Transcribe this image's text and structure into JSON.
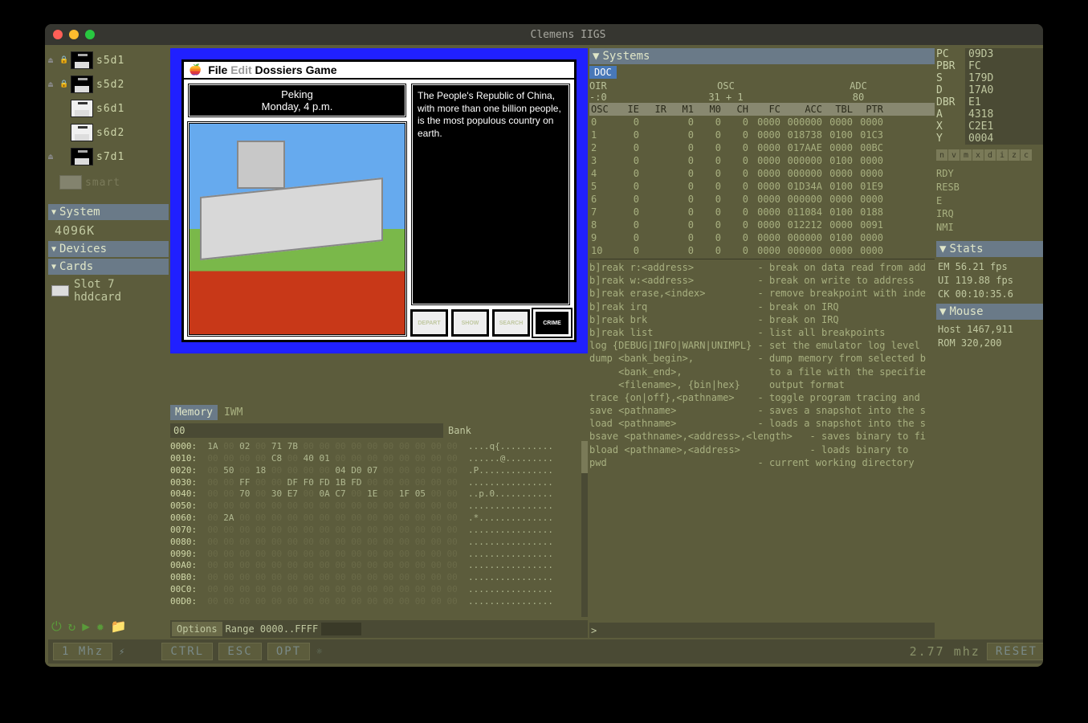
{
  "window_title": "Clemens IIGS",
  "drives": [
    {
      "label": "s5d1",
      "icon": "floppy-dark",
      "eject": true,
      "locked": true
    },
    {
      "label": "s5d2",
      "icon": "floppy-dark",
      "eject": true,
      "locked": true
    },
    {
      "label": "s6d1",
      "icon": "floppy-white",
      "eject": false,
      "locked": false
    },
    {
      "label": "s6d2",
      "icon": "floppy-white",
      "eject": false,
      "locked": false
    },
    {
      "label": "s7d1",
      "icon": "hdd",
      "eject": true,
      "locked": false
    }
  ],
  "smart_label": "smart",
  "sections": {
    "system": "System",
    "devices": "Devices",
    "cards": "Cards"
  },
  "system_memory": "4096K",
  "card_slot": {
    "label": "Slot 7",
    "sublabel": "hddcard"
  },
  "game": {
    "menus": [
      "File",
      "Edit",
      "Dossiers",
      "Game"
    ],
    "menu_disabled_index": 1,
    "location": "Peking",
    "when": "Monday, 4 p.m.",
    "text": "The People's Republic of China, with more than one billion people, is the most populous country on earth.",
    "buttons": [
      "DEPART",
      "SHOW",
      "SEARCH",
      "CRIME"
    ]
  },
  "memory": {
    "tabs": [
      "Memory",
      "IWM"
    ],
    "active_tab": 0,
    "bank_value": "00",
    "bank_label": "Bank",
    "rows": [
      {
        "addr": "0000:",
        "bytes": "1A 00 02 00 71 7B 00 00 00 00 00 00 00 00 00 00",
        "ascii": "....q{.........."
      },
      {
        "addr": "0010:",
        "bytes": "00 00 00 00 C8 00 40 01 00 00 00 00 00 00 00 00",
        "ascii": "......@........."
      },
      {
        "addr": "0020:",
        "bytes": "00 50 00 18 00 00 00 00 04 D0 07 00 00 00 00 00",
        "ascii": ".P.............."
      },
      {
        "addr": "0030:",
        "bytes": "00 00 FF 00 00 DF F0 FD 1B FD 00 00 00 00 00 00",
        "ascii": "................"
      },
      {
        "addr": "0040:",
        "bytes": "00 00 70 00 30 E7 00 0A C7 00 1E 00 1F 05 00 00",
        "ascii": "..p.0..........."
      },
      {
        "addr": "0050:",
        "bytes": "00 00 00 00 00 00 00 00 00 00 00 00 00 00 00 00",
        "ascii": "................"
      },
      {
        "addr": "0060:",
        "bytes": "00 2A 00 00 00 00 00 00 00 00 00 00 00 00 00 00",
        "ascii": ".*.............."
      },
      {
        "addr": "0070:",
        "bytes": "00 00 00 00 00 00 00 00 00 00 00 00 00 00 00 00",
        "ascii": "................"
      },
      {
        "addr": "0080:",
        "bytes": "00 00 00 00 00 00 00 00 00 00 00 00 00 00 00 00",
        "ascii": "................"
      },
      {
        "addr": "0090:",
        "bytes": "00 00 00 00 00 00 00 00 00 00 00 00 00 00 00 00",
        "ascii": "................"
      },
      {
        "addr": "00A0:",
        "bytes": "00 00 00 00 00 00 00 00 00 00 00 00 00 00 00 00",
        "ascii": "................"
      },
      {
        "addr": "00B0:",
        "bytes": "00 00 00 00 00 00 00 00 00 00 00 00 00 00 00 00",
        "ascii": "................"
      },
      {
        "addr": "00C0:",
        "bytes": "00 00 00 00 00 00 00 00 00 00 00 00 00 00 00 00",
        "ascii": "................"
      },
      {
        "addr": "00D0:",
        "bytes": "00 00 00 00 00 00 00 00 00 00 00 00 00 00 00 00",
        "ascii": "................"
      }
    ],
    "options_label": "Options",
    "range_label": "Range 0000..FFFF"
  },
  "systems": {
    "header": "Systems",
    "tab": "DOC",
    "summary_cols": [
      "OIR",
      "OSC",
      "ADC"
    ],
    "summary_vals": [
      "-:0",
      "31 + 1",
      "80"
    ],
    "osc_cols": [
      "OSC",
      "IE",
      "IR",
      "M1",
      "M0",
      "CH",
      "FC",
      "ACC",
      "TBL",
      "PTR"
    ],
    "osc_rows": [
      {
        "osc": "0",
        "ie": "0",
        "ir": "",
        "m1": "0",
        "m0": "0",
        "ch": "0",
        "fc": "0000",
        "acc": "000000",
        "tbl": "0000",
        "ptr": "0000"
      },
      {
        "osc": "1",
        "ie": "0",
        "ir": "",
        "m1": "0",
        "m0": "0",
        "ch": "0",
        "fc": "0000",
        "acc": "018738",
        "tbl": "0100",
        "ptr": "01C3"
      },
      {
        "osc": "2",
        "ie": "0",
        "ir": "",
        "m1": "0",
        "m0": "0",
        "ch": "0",
        "fc": "0000",
        "acc": "017AAE",
        "tbl": "0000",
        "ptr": "00BC"
      },
      {
        "osc": "3",
        "ie": "0",
        "ir": "",
        "m1": "0",
        "m0": "0",
        "ch": "0",
        "fc": "0000",
        "acc": "000000",
        "tbl": "0100",
        "ptr": "0000"
      },
      {
        "osc": "4",
        "ie": "0",
        "ir": "",
        "m1": "0",
        "m0": "0",
        "ch": "0",
        "fc": "0000",
        "acc": "000000",
        "tbl": "0000",
        "ptr": "0000"
      },
      {
        "osc": "5",
        "ie": "0",
        "ir": "",
        "m1": "0",
        "m0": "0",
        "ch": "0",
        "fc": "0000",
        "acc": "01D34A",
        "tbl": "0100",
        "ptr": "01E9"
      },
      {
        "osc": "6",
        "ie": "0",
        "ir": "",
        "m1": "0",
        "m0": "0",
        "ch": "0",
        "fc": "0000",
        "acc": "000000",
        "tbl": "0000",
        "ptr": "0000"
      },
      {
        "osc": "7",
        "ie": "0",
        "ir": "",
        "m1": "0",
        "m0": "0",
        "ch": "0",
        "fc": "0000",
        "acc": "011084",
        "tbl": "0100",
        "ptr": "0188"
      },
      {
        "osc": "8",
        "ie": "0",
        "ir": "",
        "m1": "0",
        "m0": "0",
        "ch": "0",
        "fc": "0000",
        "acc": "012212",
        "tbl": "0000",
        "ptr": "0091"
      },
      {
        "osc": "9",
        "ie": "0",
        "ir": "",
        "m1": "0",
        "m0": "0",
        "ch": "0",
        "fc": "0000",
        "acc": "000000",
        "tbl": "0100",
        "ptr": "0000"
      },
      {
        "osc": "10",
        "ie": "0",
        "ir": "",
        "m1": "0",
        "m0": "0",
        "ch": "0",
        "fc": "0000",
        "acc": "000000",
        "tbl": "0000",
        "ptr": "0000"
      }
    ],
    "help": "b]reak r:<address>           - break on data read from add\nb]reak w:<address>           - break on write to address\nb]reak erase,<index>         - remove breakpoint with inde\nb]reak irq                   - break on IRQ\nb]reak brk                   - break on IRQ\nb]reak list                  - list all breakpoints\nlog {DEBUG|INFO|WARN|UNIMPL} - set the emulator log level\ndump <bank_begin>,           - dump memory from selected b\n     <bank_end>,               to a file with the specifie\n     <filename>, {bin|hex}     output format\ntrace {on|off},<pathname>    - toggle program tracing and\nsave <pathname>              - saves a snapshot into the s\nload <pathname>              - loads a snapshot into the s\nbsave <pathname>,<address>,<length>   - saves binary to fi\nbload <pathname>,<address>            - loads binary to\npwd                          - current working directory",
    "prompt": "> "
  },
  "registers": [
    {
      "label": "PC",
      "value": "09D3"
    },
    {
      "label": "PBR",
      "value": "FC"
    },
    {
      "label": "S",
      "value": "179D"
    },
    {
      "label": "D",
      "value": "17A0"
    },
    {
      "label": "DBR",
      "value": "E1"
    },
    {
      "label": "A",
      "value": "4318"
    },
    {
      "label": "X",
      "value": "C2E1"
    },
    {
      "label": "Y",
      "value": "0004"
    }
  ],
  "flags": [
    "n",
    "v",
    "m",
    "x",
    "d",
    "i",
    "z",
    "c"
  ],
  "signals": [
    "RDY",
    "RESB",
    "E",
    "IRQ",
    "NMI"
  ],
  "stats_header": "Stats",
  "stats": [
    "EM  56.21 fps",
    "UI  119.88 fps",
    "CK  00:10:35.6"
  ],
  "mouse_header": "Mouse",
  "mouse": [
    "Host 1467,911",
    "ROM  320,200"
  ],
  "bottom": {
    "mhz_left": "1 Mhz",
    "keys": [
      "CTRL",
      "ESC",
      "OPT"
    ],
    "mhz_right": "2.77 mhz",
    "reset": "RESET"
  }
}
